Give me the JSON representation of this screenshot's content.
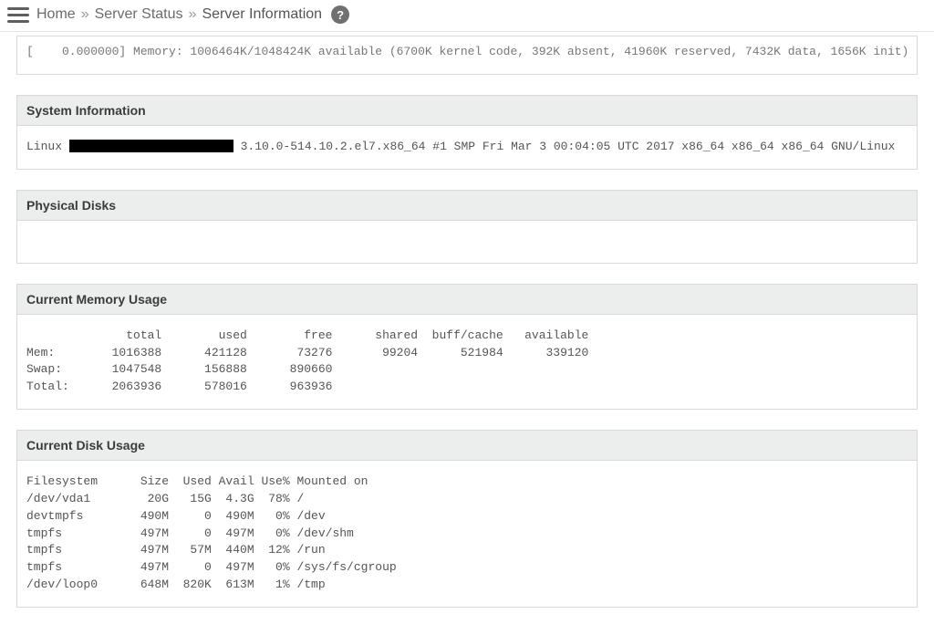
{
  "breadcrumb": {
    "items": [
      {
        "label": "Home"
      },
      {
        "label": "Server Status"
      }
    ],
    "current": "Server Information",
    "sep": "»"
  },
  "truncated_top_line": "[    0.000000] Memory: 1006464K/1048424K available (6700K kernel code, 392K absent, 41960K reserved, 7432K data, 1656K init)",
  "panels": {
    "system_info": {
      "title": "System Information",
      "os_prefix": "Linux",
      "kernel_rest": " 3.10.0-514.10.2.el7.x86_64 #1 SMP Fri Mar 3 00:04:05 UTC 2017 x86_64 x86_64 x86_64 GNU/Linux"
    },
    "physical_disks": {
      "title": "Physical Disks"
    },
    "memory": {
      "title": "Current Memory Usage",
      "text": "              total        used        free      shared  buff/cache   available\nMem:        1016388      421128       73276       99204      521984      339120\nSwap:       1047548      156888      890660\nTotal:      2063936      578016      963936"
    },
    "disk": {
      "title": "Current Disk Usage",
      "text": "Filesystem      Size  Used Avail Use% Mounted on\n/dev/vda1        20G   15G  4.3G  78% /\ndevtmpfs        490M     0  490M   0% /dev\ntmpfs           497M     0  497M   0% /dev/shm\ntmpfs           497M   57M  440M  12% /run\ntmpfs           497M     0  497M   0% /sys/fs/cgroup\n/dev/loop0      648M  820K  613M   1% /tmp"
    }
  }
}
